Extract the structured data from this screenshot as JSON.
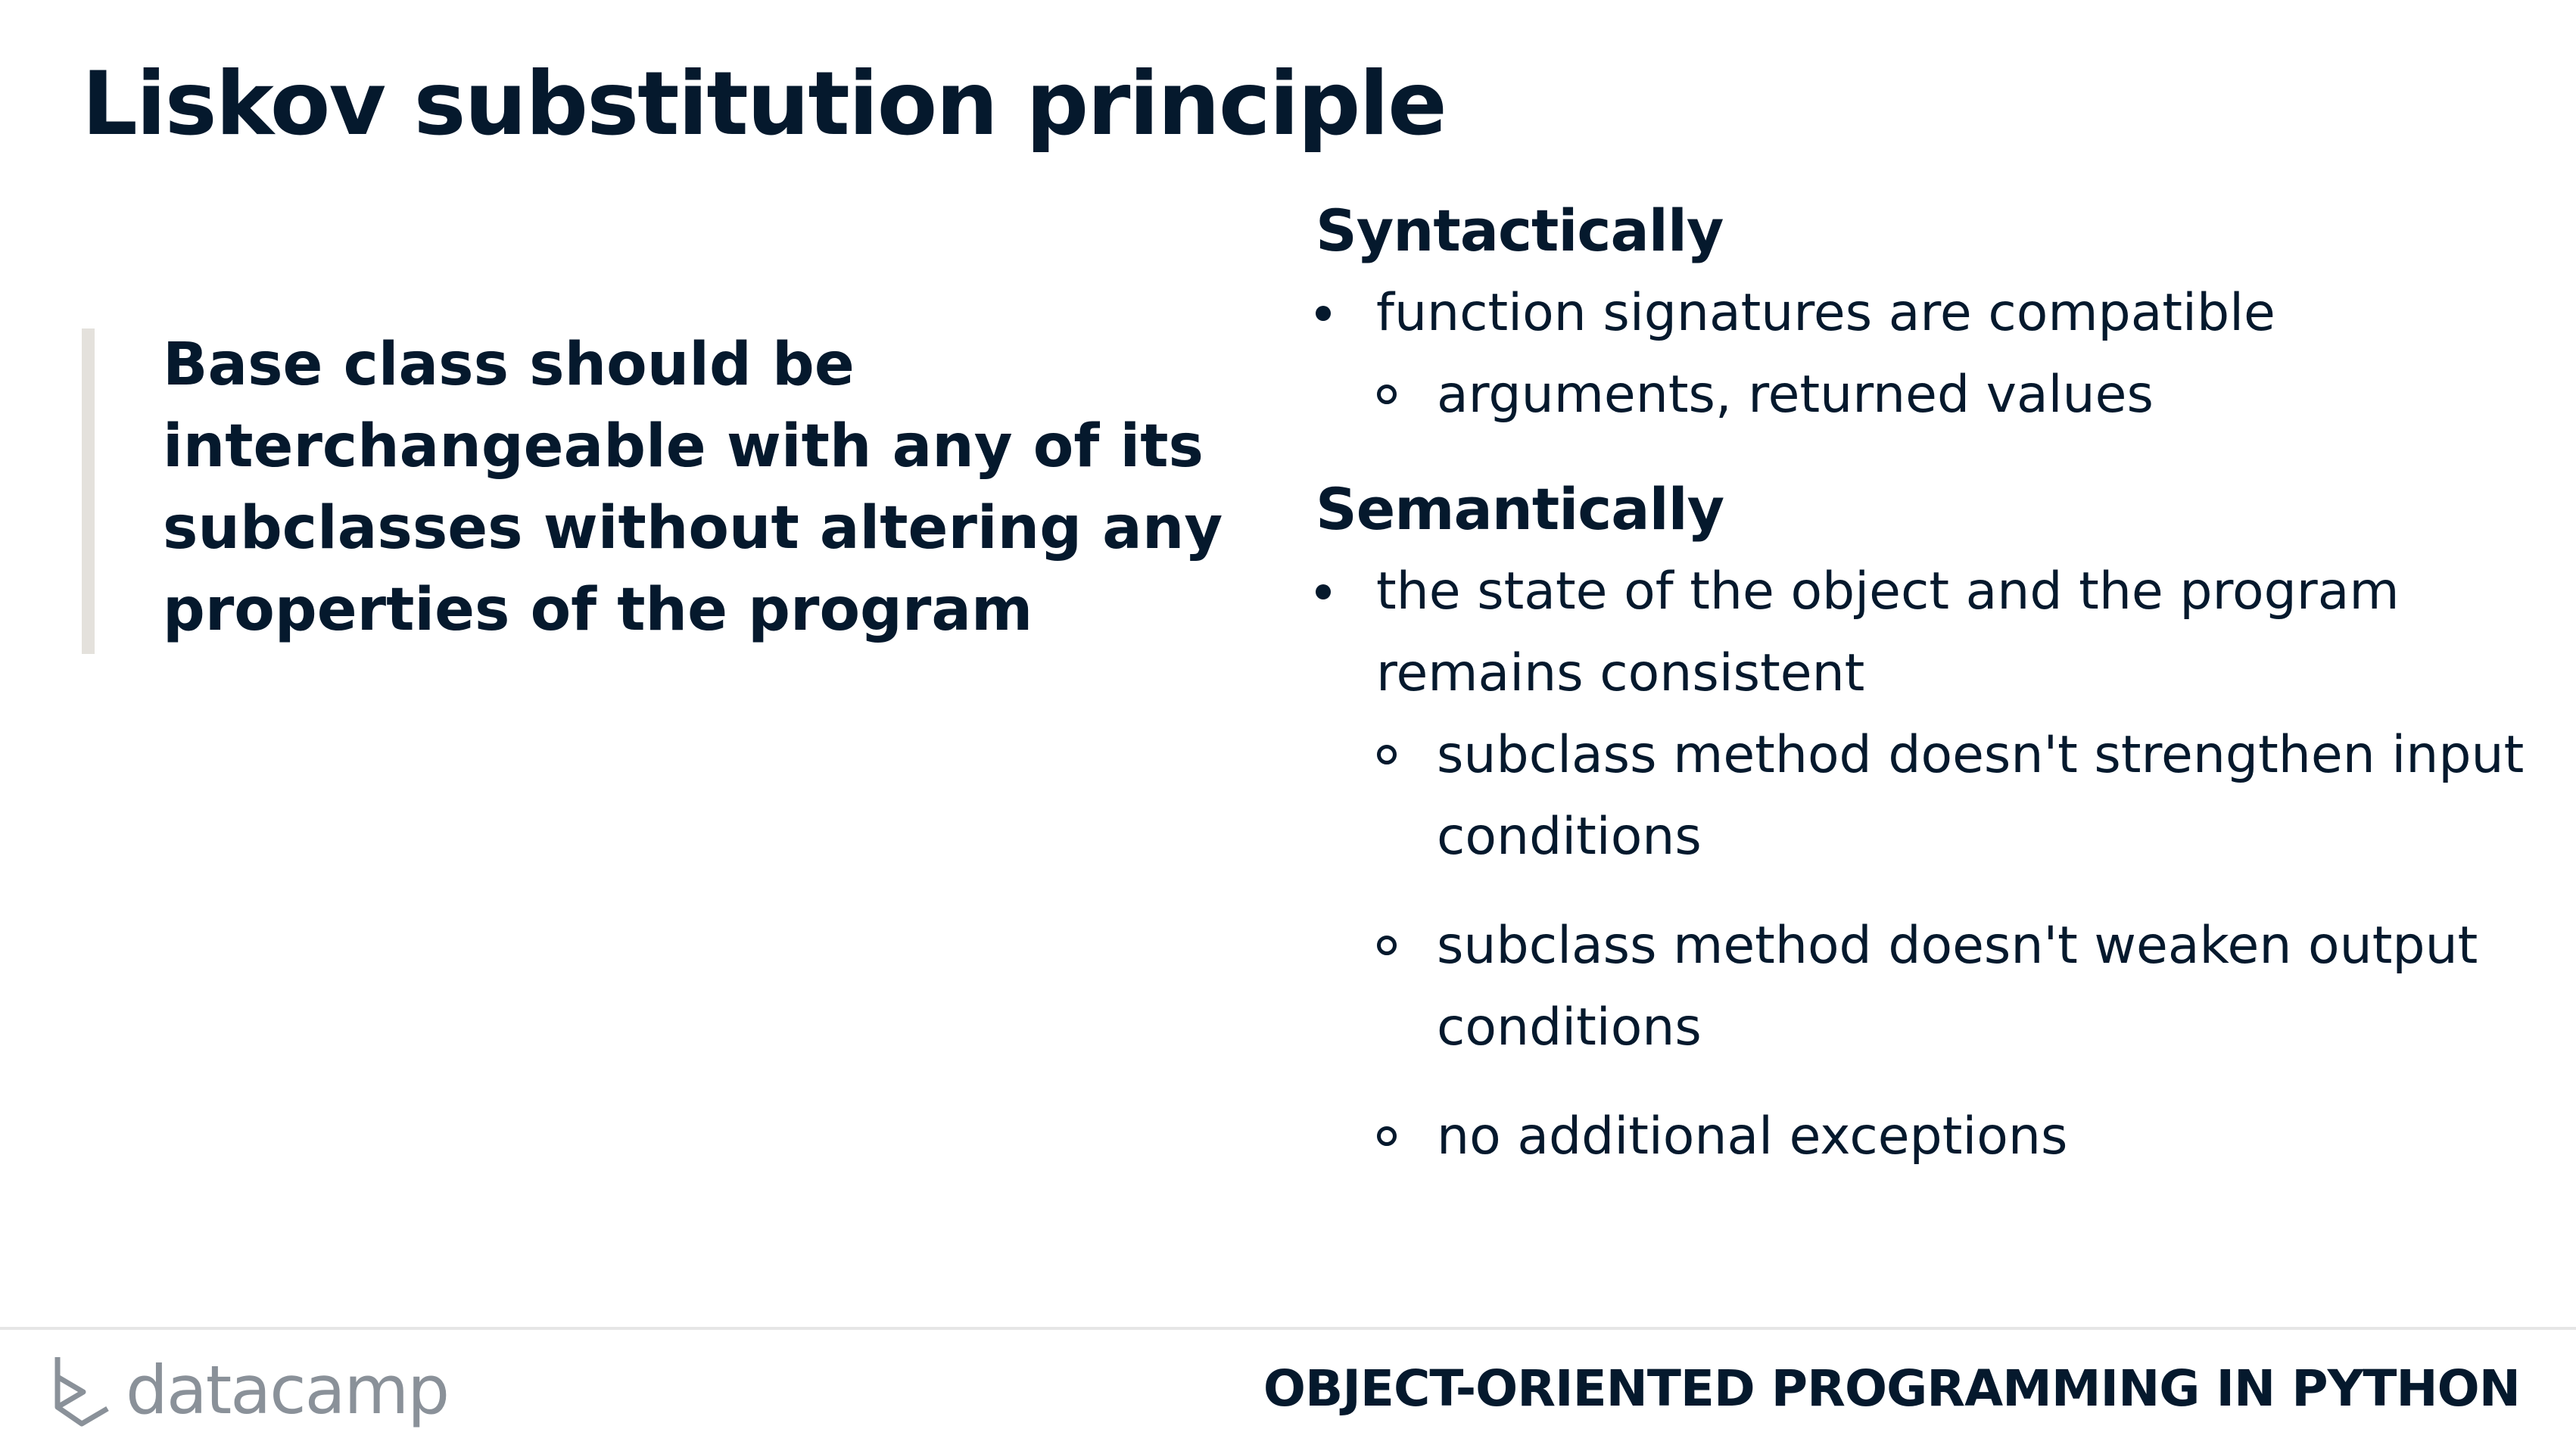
{
  "slide": {
    "title": "Liskov substitution principle"
  },
  "quote": {
    "text": "Base class should be interchangeable with any of its subclasses without altering any properties of the program"
  },
  "syntactically": {
    "heading": "Syntactically",
    "bullets": [
      {
        "text": "function signatures are compatible",
        "sub": [
          "arguments, returned values"
        ]
      }
    ]
  },
  "semantically": {
    "heading": "Semantically",
    "bullets": [
      {
        "text": "the state of the object and the program remains consistent",
        "sub": [
          "subclass method doesn't strengthen input conditions",
          "subclass method doesn't weaken output conditions",
          "no additional exceptions"
        ]
      }
    ]
  },
  "footer": {
    "logo_text": "datacamp",
    "course_title": "OBJECT-ORIENTED PROGRAMMING IN PYTHON",
    "logo_icon": "datacamp-logo-icon"
  },
  "colors": {
    "text": "#05192d",
    "quote_bar": "#e4e1dc",
    "logo": "#8a9199"
  }
}
